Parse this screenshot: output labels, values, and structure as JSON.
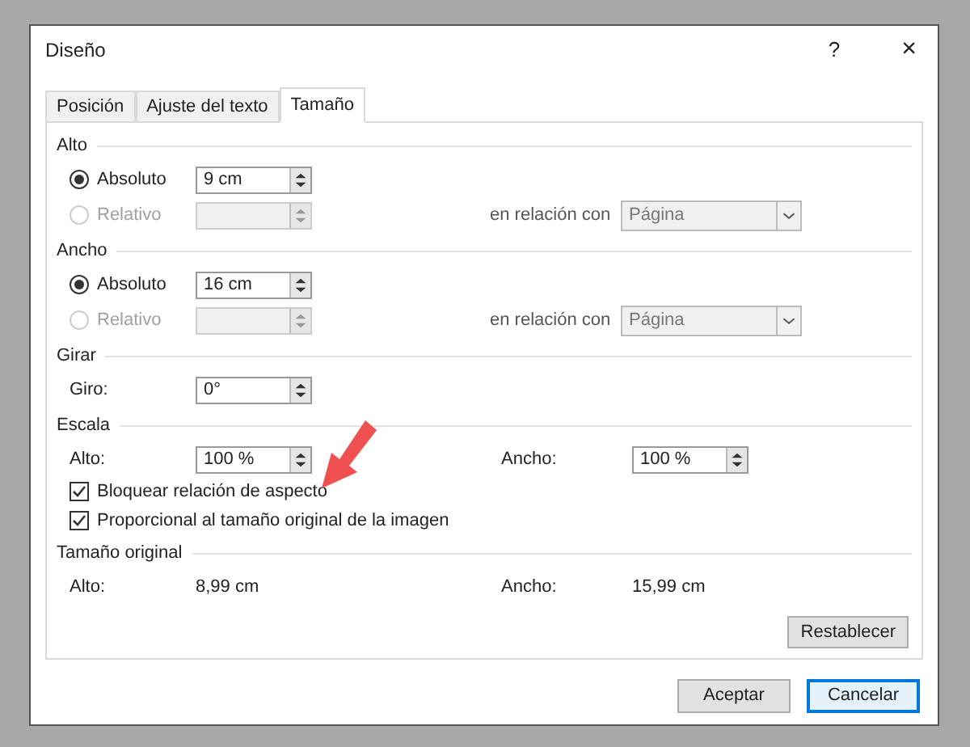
{
  "window": {
    "title": "Diseño",
    "help": "?",
    "close": "×"
  },
  "tabs": [
    {
      "label": "Posición",
      "selected": false
    },
    {
      "label": "Ajuste del texto",
      "selected": false
    },
    {
      "label": "Tamaño",
      "selected": true
    }
  ],
  "sections": [
    {
      "title": "Alto",
      "rows": [
        {
          "kind": "radio",
          "label": "Absoluto",
          "selected": true,
          "disabled": false,
          "value": "9 cm"
        },
        {
          "kind": "radio",
          "label": "Relativo",
          "selected": false,
          "disabled": true,
          "relation_label": "en relación con",
          "relation_value": "Página"
        }
      ]
    },
    {
      "title": "Ancho",
      "rows": [
        {
          "kind": "radio",
          "label": "Absoluto",
          "selected": true,
          "disabled": false,
          "value": "16 cm"
        },
        {
          "kind": "radio",
          "label": "Relativo",
          "selected": false,
          "disabled": true,
          "relation_label": "en relación con",
          "relation_value": "Página"
        }
      ]
    },
    {
      "title": "Girar",
      "rows": [
        {
          "kind": "spin",
          "label": "Giro:",
          "value": "0°"
        }
      ]
    },
    {
      "title": "Escala",
      "rows": [
        {
          "kind": "spin",
          "label": "Alto:",
          "value": "100 %",
          "label_2": "Ancho:",
          "value_2": "100 %"
        },
        {
          "kind": "checkbox",
          "label": "Bloquear relación de aspecto",
          "checked": true
        },
        {
          "kind": "checkbox",
          "label": "Proporcional al tamaño original de la imagen",
          "checked": true
        }
      ]
    },
    {
      "title": "Tamaño original",
      "rows": [
        {
          "kind": "info",
          "label": "Alto:",
          "value": "8,99 cm",
          "label_2": "Ancho:",
          "value_2": "15,99 cm"
        }
      ]
    }
  ],
  "reset_button": "Restablecer",
  "buttons": [
    {
      "label": "Aceptar",
      "focused": false
    },
    {
      "label": "Cancelar",
      "focused": true
    }
  ]
}
